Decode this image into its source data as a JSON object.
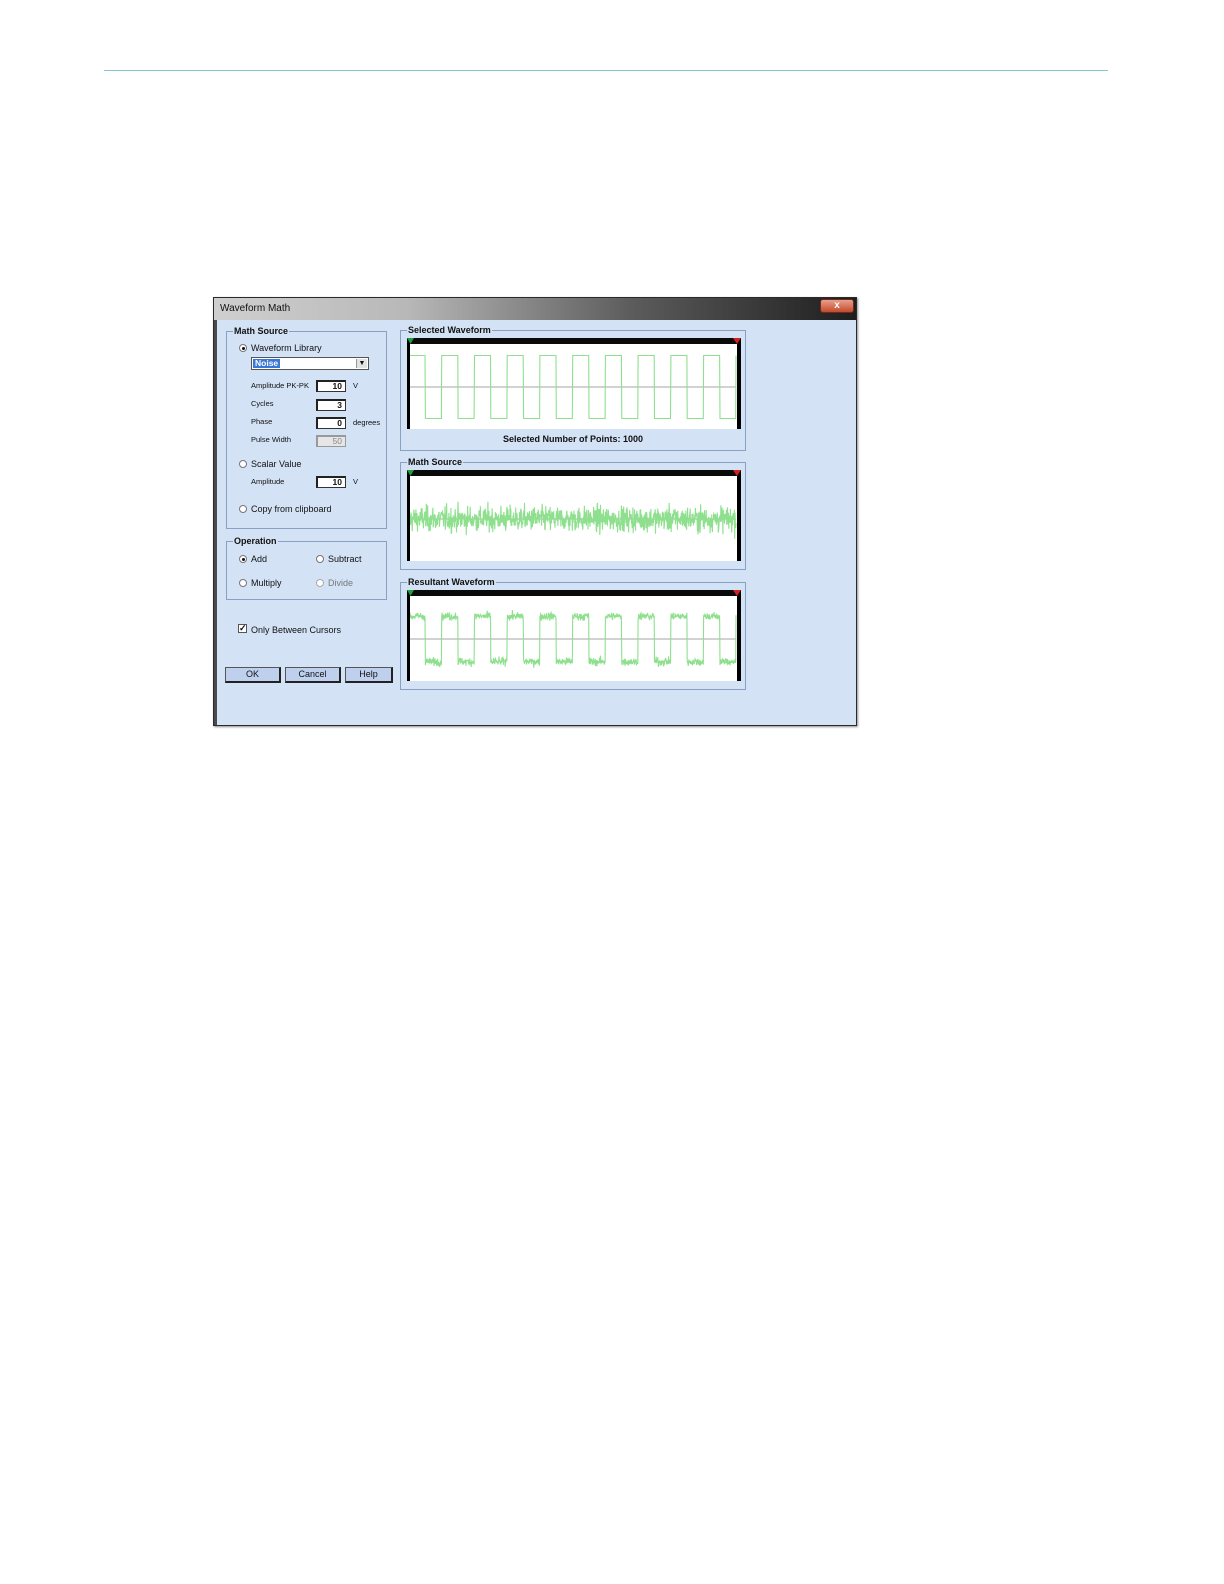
{
  "dialog": {
    "title": "Waveform Math",
    "close_label": "x"
  },
  "math_source": {
    "legend": "Math Source",
    "waveform_library_label": "Waveform Library",
    "library_selected": "Noise",
    "amplitude_label": "Amplitude PK-PK",
    "amplitude_value": "10",
    "amplitude_unit": "V",
    "cycles_label": "Cycles",
    "cycles_value": "3",
    "phase_label": "Phase",
    "phase_value": "0",
    "phase_unit": "degrees",
    "pulse_width_label": "Pulse Width",
    "pulse_width_value": "50",
    "scalar_value_label": "Scalar Value",
    "scalar_amplitude_label": "Amplitude",
    "scalar_amplitude_value": "10",
    "scalar_amplitude_unit": "V",
    "copy_clipboard_label": "Copy from clipboard",
    "selected_source": "Waveform Library"
  },
  "operation": {
    "legend": "Operation",
    "add_label": "Add",
    "subtract_label": "Subtract",
    "multiply_label": "Multiply",
    "divide_label": "Divide",
    "selected": "Add"
  },
  "only_between_cursors": {
    "label": "Only Between Cursors",
    "checked": true
  },
  "buttons": {
    "ok": "OK",
    "cancel": "Cancel",
    "help": "Help"
  },
  "panels": {
    "selected_waveform": "Selected Waveform",
    "selected_points_text": "Selected Number of Points: 1000",
    "math_source": "Math Source",
    "resultant_waveform": "Resultant Waveform"
  },
  "colors": {
    "trace": "#8ee08e",
    "dialog_bg": "#d3e2f5",
    "plot_header": "#0a0a0a",
    "start_cursor": "#1e9e3a",
    "end_cursor": "#d02020"
  },
  "chart_data": [
    {
      "type": "line",
      "name": "selected-waveform",
      "shape": "square",
      "cycles": 10,
      "points": 1000,
      "ylim": [
        -1,
        1
      ]
    },
    {
      "type": "line",
      "name": "math-source",
      "shape": "noise",
      "points": 1000,
      "ylim": [
        -1,
        1
      ]
    },
    {
      "type": "line",
      "name": "resultant-waveform",
      "shape": "square-plus-noise",
      "cycles": 10,
      "points": 1000,
      "ylim": [
        -1,
        1
      ]
    }
  ]
}
